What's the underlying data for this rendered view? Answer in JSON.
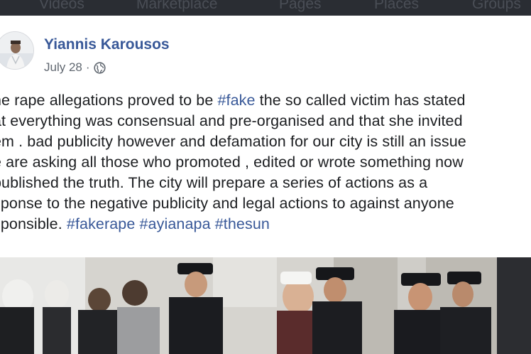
{
  "nav": {
    "tabs": [
      "Videos",
      "Marketplace",
      "Pages",
      "Places",
      "Groups"
    ]
  },
  "post": {
    "author": "Yiannis Karousos",
    "date": "July 28",
    "separator": "·",
    "privacy_icon": "globe-icon",
    "lines": [
      {
        "parts": [
          {
            "t": "he rape allegations proved to be "
          },
          {
            "t": "#fake",
            "tag": true
          },
          {
            "t": " the so called victim has stated"
          }
        ]
      },
      {
        "parts": [
          {
            "t": "at everything was consensual and pre-organised and that she invited"
          }
        ]
      },
      {
        "parts": [
          {
            "t": "em . bad publicity however and defamation for our city is still an issue"
          }
        ]
      },
      {
        "parts": [
          {
            "t": "e are asking all those who promoted , edited or wrote something now"
          }
        ]
      },
      {
        "parts": [
          {
            "t": "published the truth. The city will prepare a series of actions as a"
          }
        ]
      },
      {
        "parts": [
          {
            "t": "sponse to the negative publicity and legal actions to against anyone"
          }
        ]
      },
      {
        "parts": [
          {
            "t": "sponsible. "
          },
          {
            "t": "#fakerape",
            "tag": true
          },
          {
            "t": " "
          },
          {
            "t": "#ayianapa",
            "tag": true
          },
          {
            "t": " "
          },
          {
            "t": "#thesun",
            "tag": true
          }
        ]
      }
    ]
  },
  "colors": {
    "link": "#385898",
    "text": "#1c1e21",
    "meta": "#606770",
    "nav_bg": "#2a2d33"
  }
}
